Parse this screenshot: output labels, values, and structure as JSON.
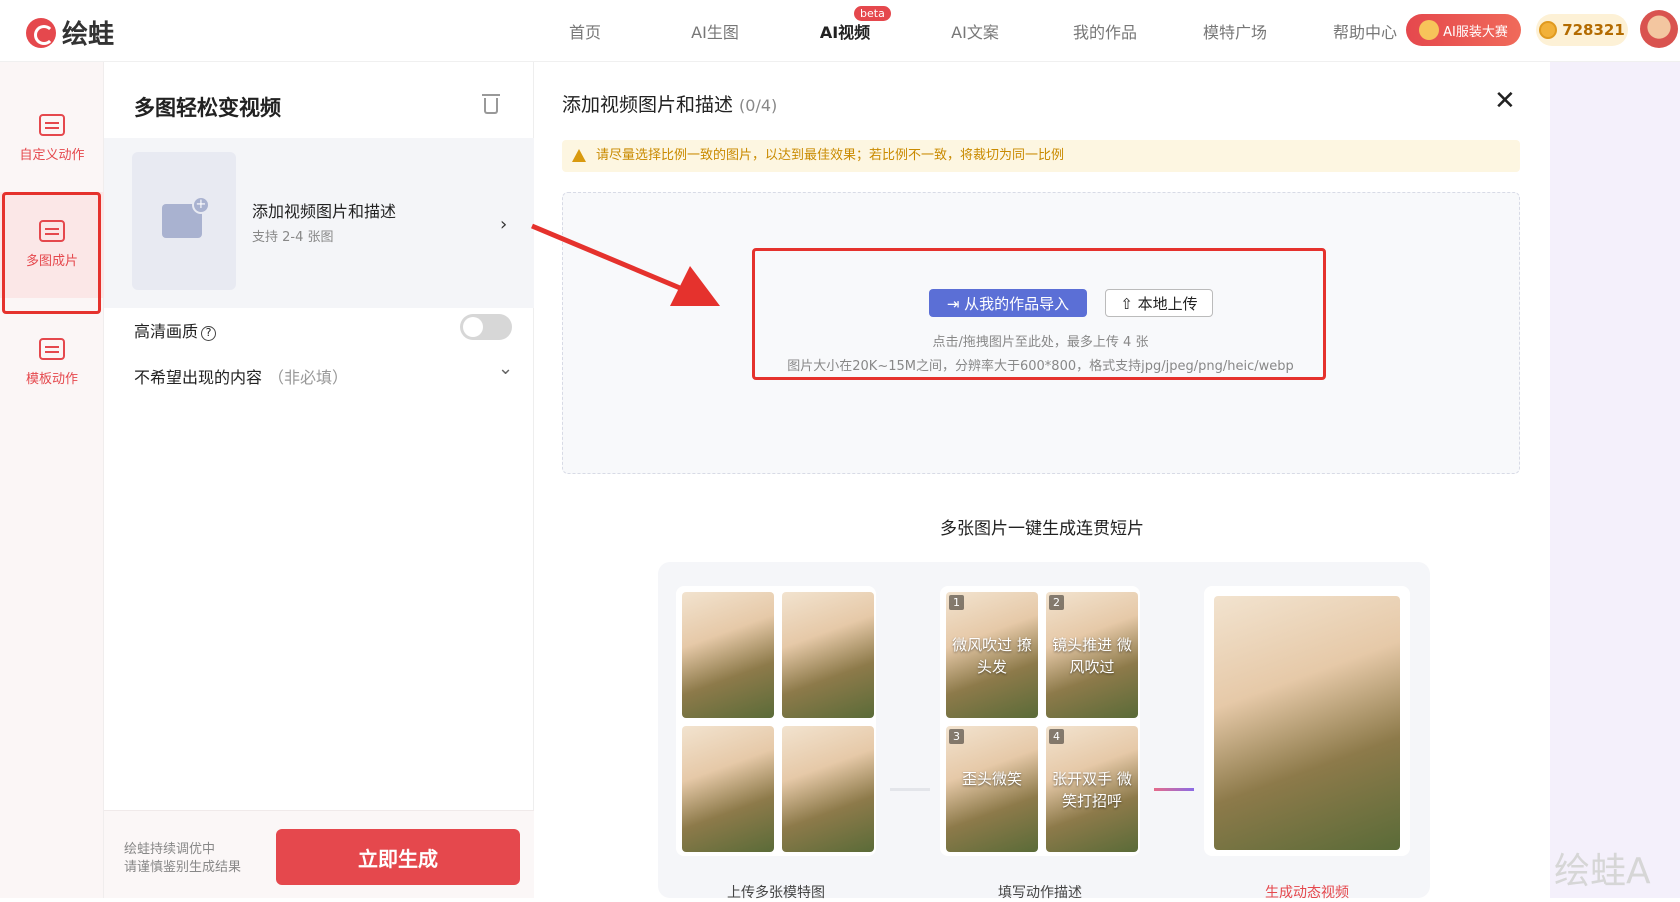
{
  "brand": {
    "name": "绘蛙",
    "color": "#e5484d"
  },
  "nav": {
    "items": [
      "首页",
      "AI生图",
      "AI视频",
      "AI文案",
      "我的作品",
      "模特广场",
      "帮助中心"
    ],
    "active": "AI视频",
    "beta": "beta"
  },
  "header": {
    "contest": "AI服装大赛",
    "coins": "728321"
  },
  "sidebar": {
    "items": [
      {
        "label": "自定义动作",
        "icon": "calendar-icon"
      },
      {
        "label": "多图成片",
        "icon": "stack-images-icon"
      },
      {
        "label": "模板动作",
        "icon": "template-icon"
      }
    ]
  },
  "panel": {
    "title": "多图轻松变视频",
    "add_title": "添加视频图片和描述",
    "add_sub": "支持 2-4 张图",
    "hd": "高清画质",
    "negative": "不希望出现的内容",
    "negative_opt": "（非必填）",
    "foot_note_1": "绘蛙持续调优中",
    "foot_note_2": "请谨慎鉴别生成结果",
    "generate": "立即生成"
  },
  "content": {
    "title": "添加视频图片和描述",
    "count": "(0/4)",
    "warning": "请尽量选择比例一致的图片，以达到最佳效果；若比例不一致，将裁切为同一比例",
    "import_btn": "从我的作品导入",
    "local_btn": "本地上传",
    "hint1": "点击/拖拽图片至此处，最多上传 4 张",
    "hint2": "图片大小在20K~15M之间，分辨率大于600*800，格式支持jpg/jpeg/png/heic/webp",
    "section_title": "多张图片一键生成连贯短片"
  },
  "demo": {
    "steps": [
      {
        "label": "上传多张模特图"
      },
      {
        "label": "填写动作描述"
      },
      {
        "label": "生成动态视频"
      }
    ],
    "captions": [
      {
        "num": "1",
        "text": "微风吹过 撩头发"
      },
      {
        "num": "2",
        "text": "镜头推进 微风吹过"
      },
      {
        "num": "3",
        "text": "歪头微笑"
      },
      {
        "num": "4",
        "text": "张开双手 微笑打招呼"
      }
    ]
  },
  "watermark": "绘蛙A"
}
